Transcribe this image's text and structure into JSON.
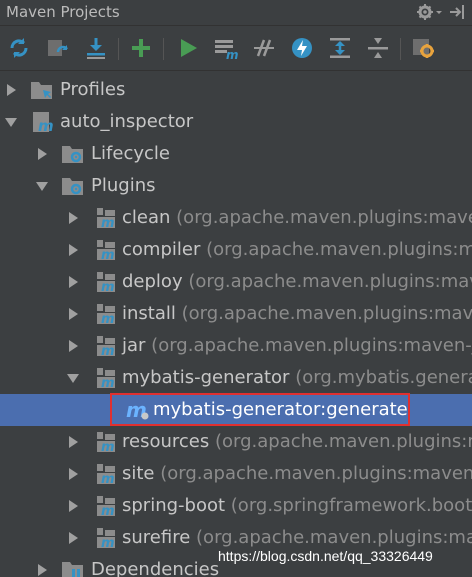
{
  "window": {
    "title": "Maven Projects"
  },
  "toolbar": {
    "buttons": [
      "reimport-all-icon",
      "generate-sources-icon",
      "download-sources-icon",
      "add-project-icon",
      "run-goal-icon",
      "execute-goal-icon",
      "toggle-offline-icon",
      "skip-tests-icon",
      "show-dependencies-icon",
      "collapse-all-icon",
      "maven-settings-icon"
    ]
  },
  "tree": {
    "profiles": "Profiles",
    "project": "auto_inspector",
    "lifecycle": "Lifecycle",
    "plugins": "Plugins",
    "plugin_items": [
      {
        "name": "clean",
        "desc": "(org.apache.maven.plugins:maven-c"
      },
      {
        "name": "compiler",
        "desc": "(org.apache.maven.plugins:mav"
      },
      {
        "name": "deploy",
        "desc": "(org.apache.maven.plugins:mave"
      },
      {
        "name": "install",
        "desc": "(org.apache.maven.plugins:mave"
      },
      {
        "name": "jar",
        "desc": "(org.apache.maven.plugins:maven-jar"
      },
      {
        "name": "mybatis-generator",
        "desc": "(org.mybatis.generat"
      },
      {
        "name": "resources",
        "desc": "(org.apache.maven.plugins:ma"
      },
      {
        "name": "site",
        "desc": "(org.apache.maven.plugins:maven-si"
      },
      {
        "name": "spring-boot",
        "desc": "(org.springframework.boot:"
      },
      {
        "name": "surefire",
        "desc": "(org.apache.maven.plugins:mave"
      }
    ],
    "goal": "mybatis-generator:generate",
    "dependencies": "Dependencies"
  },
  "watermark": "https://blog.csdn.net/qq_33326449",
  "colors": {
    "background": "#3c3f41",
    "selection": "#4b6eaf",
    "highlight_box": "#e03030",
    "accent_green": "#499c54",
    "accent_blue": "#3592c4"
  }
}
